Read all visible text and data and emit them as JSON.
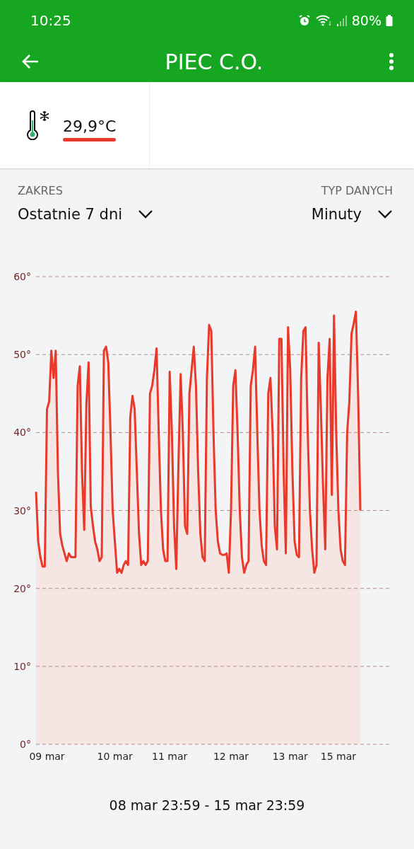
{
  "status_bar": {
    "time": "10:25",
    "battery": "80%"
  },
  "app_bar": {
    "title": "PIEC C.O."
  },
  "sensor": {
    "value": "29,9°C"
  },
  "filters": [
    {
      "label": "ZAKRES",
      "value": "Ostatnie 7 dni"
    },
    {
      "label": "TYP DANYCH",
      "value": "Minuty"
    }
  ],
  "chart_data": {
    "type": "area",
    "grid": true,
    "ylim": [
      0,
      60
    ],
    "yticks": [
      {
        "value": 0,
        "label": "0°"
      },
      {
        "value": 10,
        "label": "10°"
      },
      {
        "value": 20,
        "label": "20°"
      },
      {
        "value": 30,
        "label": "30°"
      },
      {
        "value": 40,
        "label": "40°"
      },
      {
        "value": 50,
        "label": "50°"
      },
      {
        "value": 60,
        "label": "60°"
      }
    ],
    "categories": [
      null,
      null,
      null,
      null,
      null,
      "09 mar",
      null,
      null,
      null,
      null,
      null,
      null,
      null,
      null,
      null,
      null,
      null,
      null,
      null,
      null,
      null,
      null,
      null,
      null,
      null,
      null,
      null,
      null,
      null,
      null,
      null,
      null,
      null,
      null,
      null,
      null,
      "10 mar",
      null,
      null,
      null,
      null,
      null,
      null,
      null,
      null,
      null,
      null,
      null,
      null,
      null,
      null,
      null,
      null,
      null,
      null,
      null,
      null,
      null,
      null,
      null,
      null,
      "11 mar",
      null,
      null,
      null,
      null,
      null,
      null,
      null,
      null,
      null,
      null,
      null,
      null,
      null,
      null,
      null,
      null,
      null,
      null,
      null,
      null,
      null,
      null,
      null,
      null,
      null,
      null,
      null,
      "12 mar",
      null,
      null,
      null,
      null,
      null,
      null,
      null,
      null,
      null,
      null,
      null,
      null,
      null,
      null,
      null,
      null,
      null,
      null,
      null,
      null,
      null,
      null,
      null,
      null,
      null,
      null,
      "13 mar",
      null,
      null,
      null,
      null,
      null,
      null,
      null,
      null,
      null,
      null,
      null,
      null,
      null,
      null,
      null,
      null,
      null,
      null,
      null,
      null,
      null,
      "15 mar",
      null,
      null,
      null,
      null,
      null,
      null,
      null,
      null,
      null,
      null
    ],
    "series": [
      {
        "color": "#e8392b",
        "values": [
          32.4,
          26,
          24,
          22.8,
          22.8,
          43,
          44,
          50.5,
          47,
          50.5,
          35,
          27,
          25.5,
          24.5,
          23.5,
          24.5,
          24,
          24,
          24,
          46,
          48.5,
          35,
          27.5,
          43.7,
          49,
          30.5,
          28,
          26,
          25,
          23.5,
          24,
          50.5,
          51,
          49,
          40,
          30,
          26,
          22,
          22.5,
          22,
          23,
          23.5,
          23,
          42,
          44.7,
          43,
          35,
          27,
          23,
          23.5,
          23,
          23.5,
          45,
          46,
          48,
          50.8,
          40,
          30,
          25,
          23.5,
          23.5,
          47.8,
          40,
          28,
          22.5,
          36,
          47.5,
          40,
          28,
          27,
          45,
          48,
          51,
          46,
          35,
          27,
          24,
          23.5,
          47,
          53.8,
          53,
          40,
          30,
          26,
          24.5,
          24.3,
          24.3,
          24.5,
          22,
          30,
          46,
          48,
          40,
          30,
          24,
          22,
          23,
          23.5,
          46,
          48,
          51,
          40,
          30,
          25.5,
          23.5,
          23,
          45,
          47,
          40,
          28,
          25,
          52,
          52,
          35,
          24.5,
          53.5,
          48,
          35,
          26,
          24.3,
          24,
          47,
          53,
          53.5,
          40,
          30,
          25,
          22,
          23,
          51.5,
          43,
          33,
          25,
          47,
          52,
          32,
          55,
          40,
          30,
          25,
          23.5,
          23,
          40,
          44,
          52.7,
          54,
          55.5,
          45,
          30
        ]
      }
    ]
  },
  "date_range": "08 mar 23:59 - 15 mar 23:59"
}
